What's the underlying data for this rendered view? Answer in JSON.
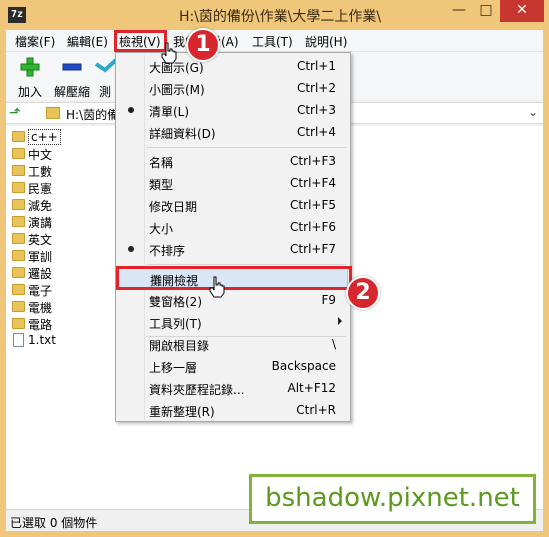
{
  "window": {
    "app_icon": "7z",
    "title": "H:\\茵的備份\\作業\\大學二上作業\\",
    "minimize_label": "—",
    "maximize_label": "□",
    "close_label": "✕"
  },
  "menubar": {
    "items": [
      {
        "label": "檔案(F)"
      },
      {
        "label": "編輯(E)"
      },
      {
        "label": "檢視(V)"
      },
      {
        "label": "我的最愛(A)"
      },
      {
        "label": "工具(T)"
      },
      {
        "label": "說明(H)"
      }
    ]
  },
  "toolbar": {
    "add_label": "加入",
    "extract_label": "解壓縮",
    "test_label": "測",
    "colors": {
      "add": "#2fb52f",
      "extract": "#1e49c9",
      "test": "#2aa9c9"
    }
  },
  "address": {
    "path": "H:\\茵的備份"
  },
  "files": [
    {
      "name": "c++",
      "type": "folder"
    },
    {
      "name": "中文",
      "type": "folder"
    },
    {
      "name": "工數",
      "type": "folder"
    },
    {
      "name": "民憲",
      "type": "folder"
    },
    {
      "name": "減免",
      "type": "folder"
    },
    {
      "name": "演講",
      "type": "folder"
    },
    {
      "name": "英文",
      "type": "folder"
    },
    {
      "name": "軍訓",
      "type": "folder"
    },
    {
      "name": "邏設",
      "type": "folder"
    },
    {
      "name": "電子",
      "type": "folder"
    },
    {
      "name": "電機",
      "type": "folder"
    },
    {
      "name": "電路",
      "type": "folder"
    },
    {
      "name": "1.txt",
      "type": "file"
    }
  ],
  "status": {
    "text": "已選取 0 個物件"
  },
  "view_menu": {
    "items": [
      {
        "label": "大圖示(G)",
        "shortcut": "Ctrl+1",
        "bullet": false
      },
      {
        "label": "小圖示(M)",
        "shortcut": "Ctrl+2",
        "bullet": false
      },
      {
        "label": "清單(L)",
        "shortcut": "Ctrl+3",
        "bullet": true
      },
      {
        "label": "詳細資料(D)",
        "shortcut": "Ctrl+4",
        "bullet": false
      },
      {
        "label": "名稱",
        "shortcut": "Ctrl+F3",
        "bullet": false
      },
      {
        "label": "類型",
        "shortcut": "Ctrl+F4",
        "bullet": false
      },
      {
        "label": "修改日期",
        "shortcut": "Ctrl+F5",
        "bullet": false
      },
      {
        "label": "大小",
        "shortcut": "Ctrl+F6",
        "bullet": false
      },
      {
        "label": "不排序",
        "shortcut": "Ctrl+F7",
        "bullet": true
      },
      {
        "label": "攤開檢視",
        "shortcut": "",
        "bullet": false,
        "highlighted": true
      },
      {
        "label": "雙窗格(2)",
        "shortcut": "F9",
        "bullet": false
      },
      {
        "label": "工具列(T)",
        "shortcut": "",
        "bullet": false,
        "submenu": true
      },
      {
        "label": "開啟根目錄",
        "shortcut": "\\",
        "bullet": false
      },
      {
        "label": "上移一層",
        "shortcut": "Backspace",
        "bullet": false
      },
      {
        "label": "資料夾歷程記錄...",
        "shortcut": "Alt+F12",
        "bullet": false
      },
      {
        "label": "重新整理(R)",
        "shortcut": "Ctrl+R",
        "bullet": false
      }
    ]
  },
  "annotations": {
    "badge_1": "1",
    "badge_2": "2",
    "accent_color": "#e0242b"
  },
  "watermark": {
    "text": "bshadow.pixnet.net",
    "color": "#5b9a1f"
  }
}
